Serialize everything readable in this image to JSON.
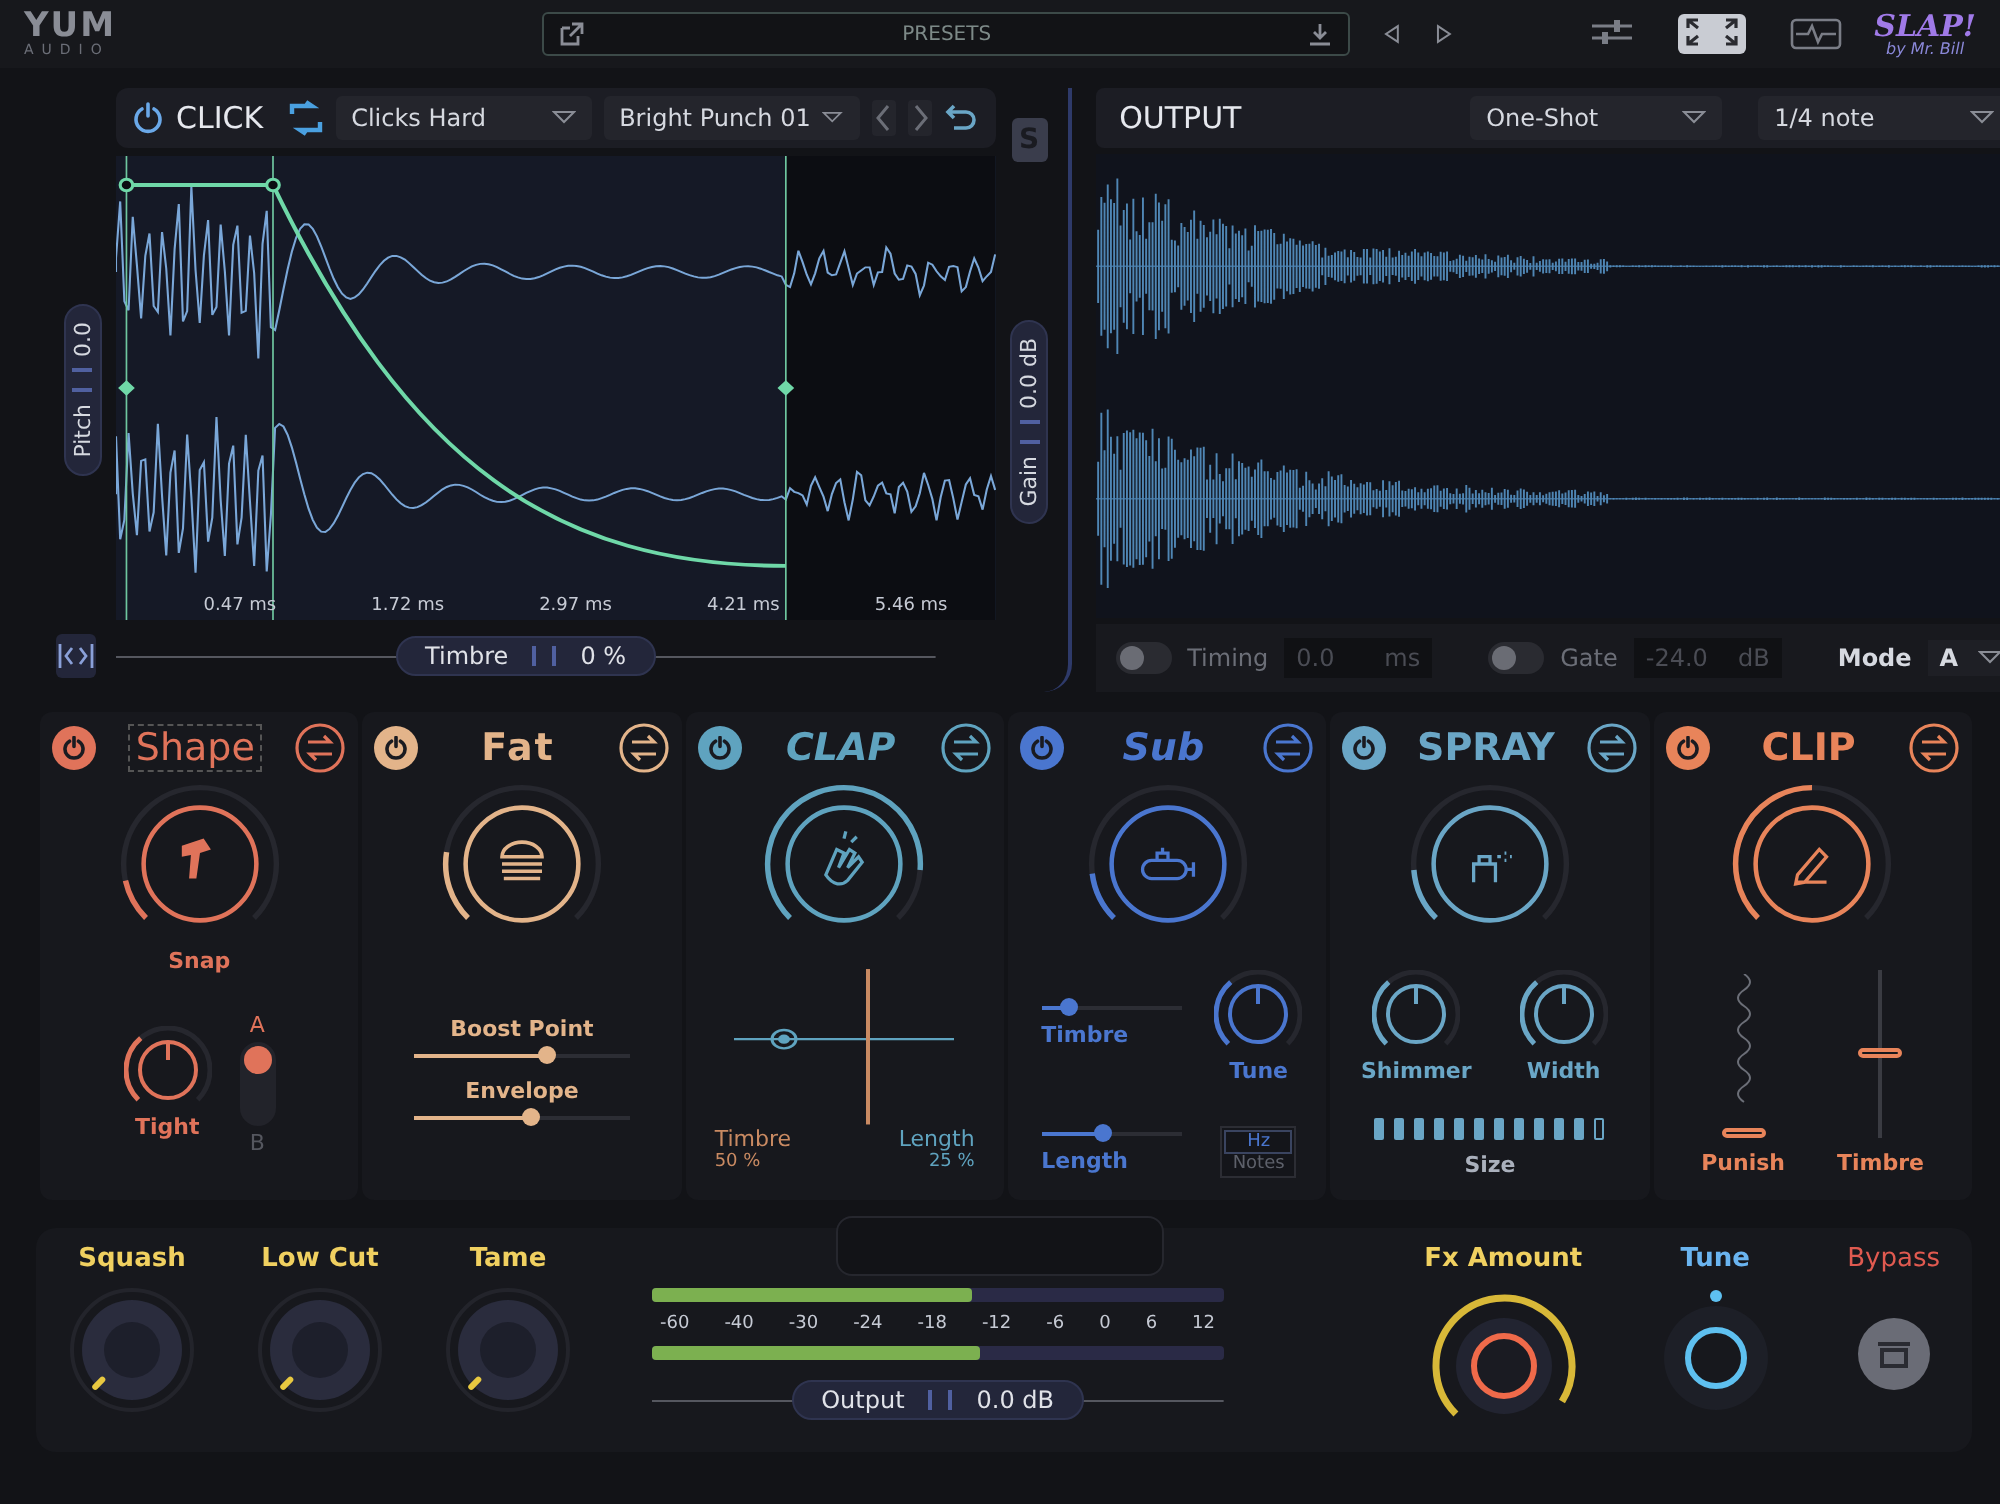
{
  "header": {
    "logo": "YUM",
    "logo_sub": "AUDIO",
    "presets": "PRESETS",
    "views": [
      {
        "kind": "sliders",
        "selected": false
      },
      {
        "kind": "expand",
        "selected": true
      },
      {
        "kind": "scope",
        "selected": false
      }
    ],
    "brand": "SLAP!",
    "brand_sub": "by Mr. Bill"
  },
  "click": {
    "title": "CLICK",
    "on": true,
    "source": "Clicks Hard",
    "preset": "Bright Punch 01",
    "solo": "S",
    "pitch": {
      "label": "Pitch",
      "value": "0.0",
      "level": 0.5
    },
    "gain": {
      "label": "Gain",
      "value": "0.0 dB",
      "level": 0.5
    },
    "times": [
      "0.47 ms",
      "1.72 ms",
      "2.97 ms",
      "4.21 ms",
      "5.46 ms"
    ],
    "timbre": {
      "label": "Timbre",
      "value": "0 %"
    }
  },
  "output": {
    "title": "OUTPUT",
    "trigger": "One-Shot",
    "length": "1/4 note",
    "timing": {
      "label": "Timing",
      "on": false,
      "value": "0.0",
      "unit": "ms"
    },
    "gate": {
      "label": "Gate",
      "on": false,
      "value": "-24.0",
      "unit": "dB"
    },
    "mode": {
      "label": "Mode",
      "value": "A"
    }
  },
  "modules": [
    {
      "kind": "shape",
      "title": "Shape",
      "on": true,
      "color": "#e0735a",
      "knob": {
        "label": "Snap"
      },
      "controls": [
        {
          "kind": "knob",
          "label": "Tight"
        },
        {
          "kind": "switch",
          "options": [
            {
              "label": "A",
              "selected": true
            },
            {
              "label": "B",
              "selected": false
            }
          ]
        }
      ]
    },
    {
      "kind": "fat",
      "title": "Fat",
      "on": true,
      "color": "#e3b48a",
      "controls": [
        {
          "kind": "slider",
          "label": "Boost Point",
          "level": 0.62
        },
        {
          "kind": "slider",
          "label": "Envelope",
          "level": 0.55
        }
      ]
    },
    {
      "kind": "clap",
      "title": "CLAP",
      "on": true,
      "color": "#5fa3bf",
      "controls": [
        {
          "kind": "xy",
          "x_label": "Timbre",
          "x_value": "50 %",
          "y_label": "Length",
          "y_value": "25 %"
        }
      ]
    },
    {
      "kind": "sub",
      "title": "Sub",
      "on": true,
      "color": "#4a76cf",
      "controls": [
        {
          "kind": "slider",
          "label": "Timbre",
          "level": 0.2
        },
        {
          "kind": "slider",
          "label": "Length",
          "level": 0.45
        },
        {
          "kind": "knob",
          "label": "Tune"
        },
        {
          "kind": "units",
          "options": [
            {
              "label": "Hz",
              "selected": true
            },
            {
              "label": "Notes",
              "selected": false
            }
          ]
        }
      ]
    },
    {
      "kind": "spray",
      "title": "SPRAY",
      "on": true,
      "color": "#6aa6c6",
      "controls": [
        {
          "kind": "knob",
          "label": "Shimmer"
        },
        {
          "kind": "knob",
          "label": "Width"
        },
        {
          "kind": "segments",
          "label": "Size",
          "level": 0.92
        }
      ]
    },
    {
      "kind": "clip",
      "title": "CLIP",
      "on": true,
      "color": "#e8845a",
      "controls": [
        {
          "kind": "spring",
          "label": "Punish",
          "level": 0
        },
        {
          "kind": "vslider",
          "label": "Timbre",
          "level": 0.55
        }
      ]
    }
  ],
  "master": {
    "knobs": [
      {
        "label": "Squash"
      },
      {
        "label": "Low Cut"
      },
      {
        "label": "Tame"
      }
    ],
    "meters": [
      {
        "level": 0.56
      },
      {
        "level": 0.575
      }
    ],
    "scale": [
      "-60",
      "-40",
      "-30",
      "-24",
      "-18",
      "-12",
      "-6",
      "0",
      "6",
      "12"
    ],
    "output": {
      "label": "Output",
      "value": "0.0 dB",
      "level": 0.5
    },
    "fx_amount": {
      "label": "Fx Amount"
    },
    "tune": {
      "label": "Tune"
    },
    "bypass": {
      "label": "Bypass",
      "on": false
    }
  }
}
